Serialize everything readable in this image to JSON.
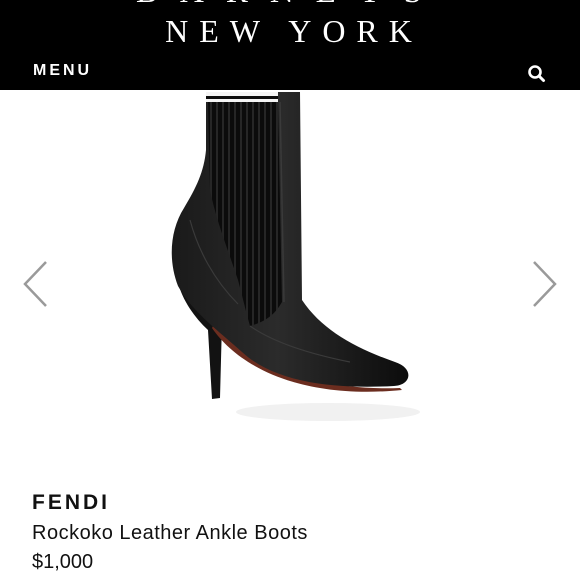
{
  "header": {
    "logo_top": "BARNEYS",
    "logo_bottom": "NEW YORK",
    "menu_label": "MENU",
    "search_icon": "search-icon"
  },
  "gallery": {
    "prev_icon": "chevron-left-icon",
    "next_icon": "chevron-right-icon"
  },
  "product": {
    "brand": "FENDI",
    "name": "Rockoko Leather Ankle Boots",
    "price": "$1,000"
  },
  "colors": {
    "header_bg": "#000000",
    "header_text": "#ffffff",
    "arrow": "#9a9a9a",
    "text": "#111111"
  }
}
